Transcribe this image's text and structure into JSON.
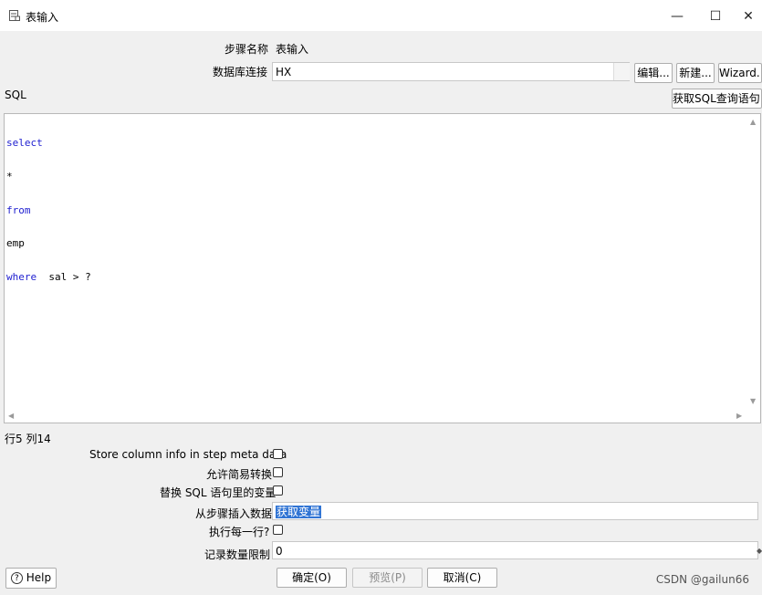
{
  "window": {
    "title": "表输入",
    "minimize_glyph": "—",
    "maximize_glyph": "☐",
    "close_glyph": "✕"
  },
  "form": {
    "step_name_label": "步骤名称",
    "step_name_value": "表输入",
    "db_conn_label": "数据库连接",
    "db_conn_value": "HX",
    "edit_button": "编辑...",
    "new_button": "新建...",
    "wizard_button": "Wizard...",
    "sql_label": "SQL",
    "get_sql_button": "获取SQL查询语句..."
  },
  "sql": {
    "lines": [
      {
        "kw": "select",
        "text": ""
      },
      {
        "kw": "",
        "text": "*"
      },
      {
        "kw": "from",
        "text": ""
      },
      {
        "kw": "",
        "text": "emp"
      },
      {
        "kw": "where",
        "text": "  sal > ?"
      }
    ]
  },
  "status": {
    "cursor_position": "行5 列14"
  },
  "options": {
    "store_column_info_label": "Store column info in step meta data",
    "store_column_info_checked": false,
    "lazy_conversion_label": "允许简易转换",
    "lazy_conversion_checked": false,
    "replace_vars_label": "替换 SQL 语句里的变量",
    "replace_vars_checked": false,
    "insert_from_step_label": "从步骤插入数据",
    "insert_from_step_value": "获取变量",
    "execute_each_row_label": "执行每一行?",
    "execute_each_row_checked": false,
    "limit_label": "记录数量限制",
    "limit_value": "0"
  },
  "footer": {
    "help_button": "Help",
    "ok_button": "确定(O)",
    "preview_button": "预览(P)",
    "cancel_button": "取消(C)",
    "watermark": "CSDN @gailun66"
  }
}
